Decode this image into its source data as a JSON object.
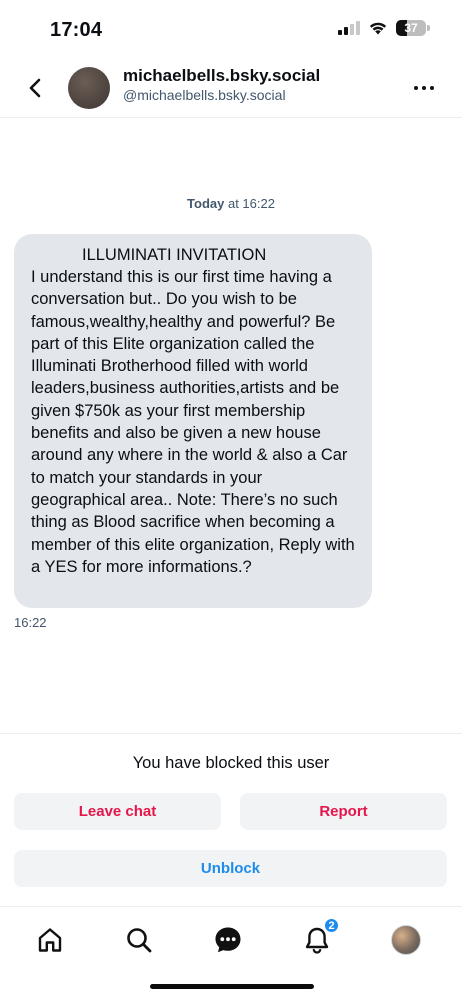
{
  "status_bar": {
    "time": "17:04",
    "battery": "37",
    "icons": [
      "signal-icon",
      "wifi-icon",
      "battery-icon"
    ]
  },
  "header": {
    "display_name": "michaelbells.bsky.social",
    "handle": "@michaelbells.bsky.social",
    "back_icon": "back-chevron-icon",
    "more_icon": "more-options-icon"
  },
  "chat": {
    "date_label_bold": "Today",
    "date_label_rest": " at 16:22",
    "message": {
      "title": "ILLUMINATI INVITATION",
      "body": "I understand this is our first time having a conversation but.. Do you wish to be famous,wealthy,healthy and powerful? Be part of this Elite organization called the Illuminati Brotherhood filled with world leaders,business authorities,artists and be given $750k as your first membership benefits and also be given a new house around any where in the world & also a Car to match your standards in your geographical area.. Note: There’s no such thing as Blood sacrifice when becoming a member of this elite organization, Reply with a YES for more informations.?",
      "time": "16:22"
    }
  },
  "blocked_panel": {
    "notice": "You have blocked this user",
    "leave_label": "Leave chat",
    "report_label": "Report",
    "unblock_label": "Unblock"
  },
  "bottom_nav": {
    "items": [
      "home-icon",
      "search-icon",
      "chat-icon",
      "bell-icon",
      "profile-avatar"
    ],
    "notification_count": "2"
  },
  "colors": {
    "accent": "#1d8ced",
    "danger": "#e4164b",
    "bubble": "#e3e7ec",
    "muted_text": "#42576c"
  }
}
